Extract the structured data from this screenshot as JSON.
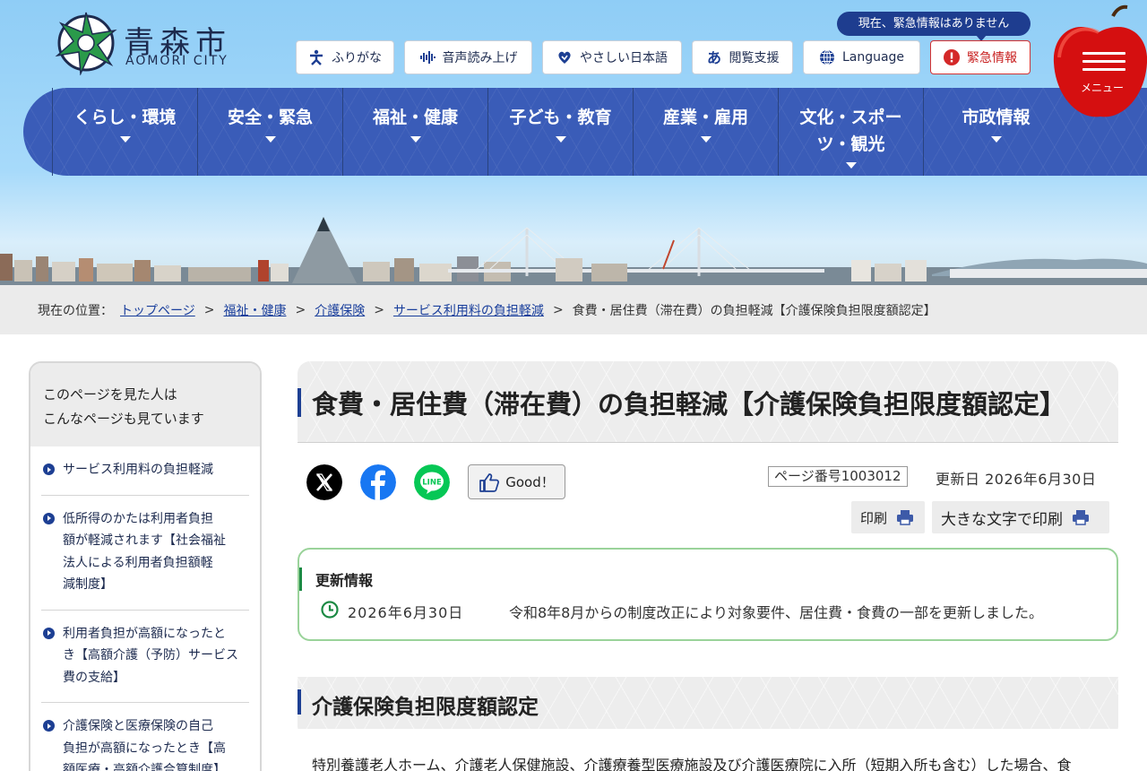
{
  "header": {
    "logo_ja": "青森市",
    "logo_en": "AOMORI CITY",
    "emergency_note": "現在、緊急情報はありません",
    "utility": [
      {
        "label": "ふりがな",
        "icon": "furigana-icon"
      },
      {
        "label": "音声読み上げ",
        "icon": "audio-wave-icon"
      },
      {
        "label": "やさしい日本語",
        "icon": "heart-hand-icon"
      },
      {
        "label": "閲覧支援",
        "icon": "reading-support-icon"
      },
      {
        "label": "Language",
        "icon": "globe-icon"
      },
      {
        "label": "緊急情報",
        "icon": "exclamation-icon"
      }
    ],
    "menu_label": "メニュー",
    "nav": [
      "くらし・環境",
      "安全・緊急",
      "福祉・健康",
      "子ども・教育",
      "産業・雇用",
      "文化・スポーツ・観光",
      "市政情報"
    ]
  },
  "breadcrumb": {
    "prefix": "現在の位置：",
    "links": [
      "トップページ",
      "福祉・健康",
      "介護保険",
      "サービス利用料の負担軽減"
    ],
    "current": "食費・居住費（滞在費）の負担軽減【介護保険負担限度額認定】"
  },
  "sidebar": {
    "heading_line1": "このページを見た人は",
    "heading_line2": "こんなページも見ています",
    "items": [
      [
        "サービス利用料の負担軽減"
      ],
      [
        "低所得のかたは利用者負担",
        "額が軽減されます【社会福祉",
        "法人による利用者負担額軽",
        "減制度】"
      ],
      [
        "利用者負担が高額になったと",
        "き【高額介護（予防）サービス",
        "費の支給】"
      ],
      [
        "介護保険と医療保険の自己",
        "負担が高額になったとき【高",
        "額医療・高額介護合算制度】"
      ]
    ]
  },
  "main": {
    "title": "食費・居住費（滞在費）の負担軽減【介護保険負担限度額認定】",
    "share": [
      "x-icon",
      "facebook-icon",
      "line-icon"
    ],
    "line_label": "LINE",
    "good_label": "Good！",
    "page_number": "ページ番号1003012",
    "updated": "更新日 2026年6月30日",
    "print_label": "印刷",
    "print_large_label": "大きな文字で印刷",
    "update_info": {
      "heading": "更新情報",
      "date": "2026年6月30日",
      "text": "令和8年8月からの制度改正により対象要件、居住費・食費の一部を更新しました。"
    },
    "section_title": "介護保険負担限度額認定",
    "body_text": "特別養護老人ホーム、介護老人保健施設、介護療養型医療施設及び介護医療院に入所（短期入所も含む）した場合、食"
  },
  "colors": {
    "nav_blue": "#3a5cb8",
    "accent_navy": "#1d3f93",
    "emergency_red": "#d43232",
    "update_green": "#9ad39a"
  }
}
